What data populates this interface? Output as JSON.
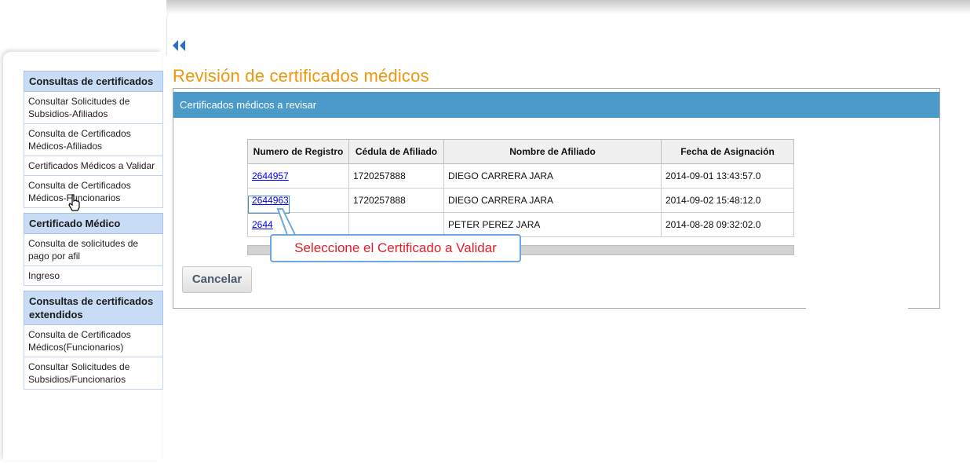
{
  "sidebar": {
    "sections": [
      {
        "title": "Consultas de certificados",
        "items": [
          "Consultar Solicitudes de Subsidios-Afiliados",
          "Consulta de Certificados Médicos-Afiliados",
          "Certificados Médicos a Validar",
          "Consulta de Certificados Médicos-Funcionarios"
        ]
      },
      {
        "title": "Certificado Médico",
        "items": [
          "Consulta de solicitudes de pago por afil",
          "Ingreso"
        ]
      },
      {
        "title": "Consultas de certificados extendidos",
        "items": [
          "Consulta de Certificados Médicos(Funcionarios)",
          "Consultar Solicitudes de Subsidios/Funcionarios"
        ]
      }
    ]
  },
  "icons": {
    "back": "double-left-arrow-icon",
    "cursor": "hand-pointer-icon"
  },
  "page_title": "Revisión de certificados médicos",
  "panel_header": "Certificados médicos a revisar",
  "table": {
    "columns": [
      "Numero de Registro",
      "Cédula de Afiliado",
      "Nombre de Afiliado",
      "Fecha de Asignación"
    ],
    "rows": [
      {
        "registro": "2644957",
        "cedula": "1720257888",
        "nombre": "DIEGO CARRERA JARA",
        "fecha": "2014-09-01 13:43:57.0"
      },
      {
        "registro": "2644963",
        "cedula": "1720257888",
        "nombre": "DIEGO CARRERA JARA",
        "fecha": "2014-09-02 15:48:12.0"
      },
      {
        "registro": "2644",
        "cedula": "",
        "nombre": "PETER PEREZ JARA",
        "fecha": "2014-08-28 09:32:02.0"
      }
    ]
  },
  "cancel_label": "Cancelar",
  "callout_text": "Seleccione el Certificado a Validar",
  "colors": {
    "accent_title": "#f0960a",
    "panel_header": "#4a9bc9",
    "sidebar_head": "#c9dcf5",
    "callout_text": "#e0202c"
  }
}
